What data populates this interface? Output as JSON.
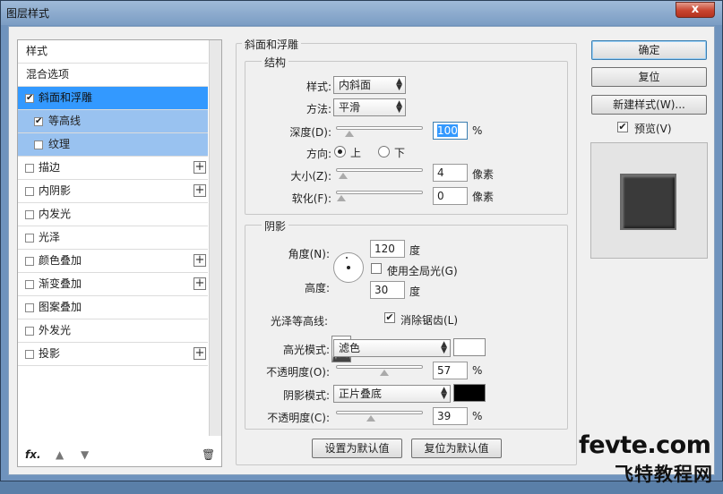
{
  "window": {
    "title": "图层样式",
    "close_glyph": "x"
  },
  "styles_list": [
    {
      "label": "样式",
      "checkbox": false,
      "checked": false,
      "plus": false,
      "state": "plain"
    },
    {
      "label": "混合选项",
      "checkbox": false,
      "checked": false,
      "plus": false,
      "state": "plain"
    },
    {
      "label": "斜面和浮雕",
      "checkbox": true,
      "checked": true,
      "plus": false,
      "state": "selected"
    },
    {
      "label": "等高线",
      "checkbox": true,
      "checked": true,
      "plus": false,
      "state": "sub"
    },
    {
      "label": "纹理",
      "checkbox": true,
      "checked": false,
      "plus": false,
      "state": "sub"
    },
    {
      "label": "描边",
      "checkbox": true,
      "checked": false,
      "plus": true,
      "state": "normal"
    },
    {
      "label": "内阴影",
      "checkbox": true,
      "checked": false,
      "plus": true,
      "state": "normal"
    },
    {
      "label": "内发光",
      "checkbox": true,
      "checked": false,
      "plus": false,
      "state": "normal"
    },
    {
      "label": "光泽",
      "checkbox": true,
      "checked": false,
      "plus": false,
      "state": "normal"
    },
    {
      "label": "颜色叠加",
      "checkbox": true,
      "checked": false,
      "plus": true,
      "state": "normal"
    },
    {
      "label": "渐变叠加",
      "checkbox": true,
      "checked": false,
      "plus": true,
      "state": "normal"
    },
    {
      "label": "图案叠加",
      "checkbox": true,
      "checked": false,
      "plus": false,
      "state": "normal"
    },
    {
      "label": "外发光",
      "checkbox": true,
      "checked": false,
      "plus": false,
      "state": "normal"
    },
    {
      "label": "投影",
      "checkbox": true,
      "checked": false,
      "plus": true,
      "state": "normal"
    }
  ],
  "left_tools": {
    "fx": "fx.",
    "up_icon": "arrow-up-icon",
    "down_icon": "arrow-down-icon",
    "trash_icon": "trash-icon"
  },
  "bevel": {
    "section_title": "斜面和浮雕",
    "structure_title": "结构",
    "style_label": "样式:",
    "style_value": "内斜面",
    "technique_label": "方法:",
    "technique_value": "平滑",
    "depth_label": "深度(D):",
    "depth_value": "100",
    "depth_unit": "%",
    "depth_level": 0.1,
    "direction_label": "方向:",
    "direction_up": "上",
    "direction_down": "下",
    "direction_selected": "up",
    "size_label": "大小(Z):",
    "size_value": "4",
    "size_unit": "像素",
    "size_level": 0.02,
    "soften_label": "软化(F):",
    "soften_value": "0",
    "soften_unit": "像素",
    "soften_level": 0
  },
  "shading": {
    "title": "阴影",
    "angle_label": "角度(N):",
    "angle_value": "120",
    "angle_unit": "度",
    "global_light_label": "使用全局光(G)",
    "global_light_checked": false,
    "altitude_label": "高度:",
    "altitude_value": "30",
    "altitude_unit": "度",
    "gloss_label": "光泽等高线:",
    "antialias_label": "消除锯齿(L)",
    "antialias_checked": true,
    "highlight_label": "高光模式:",
    "highlight_mode": "滤色",
    "highlight_color": "#ffffff",
    "hl_opacity_label": "不透明度(O):",
    "hl_opacity_value": "57",
    "hl_opacity_unit": "%",
    "hl_opacity_level": 0.57,
    "shadow_label": "阴影模式:",
    "shadow_mode": "正片叠底",
    "shadow_color": "#000000",
    "sh_opacity_label": "不透明度(C):",
    "sh_opacity_value": "39",
    "sh_opacity_unit": "%",
    "sh_opacity_level": 0.39
  },
  "footer_buttons": {
    "make_default": "设置为默认值",
    "reset_default": "复位为默认值"
  },
  "right": {
    "ok": "确定",
    "reset": "复位",
    "new_style": "新建样式(W)...",
    "preview_label": "预览(V)",
    "preview_checked": true
  },
  "watermark": {
    "line1": "fevte.com",
    "line2": "飞特教程网"
  }
}
